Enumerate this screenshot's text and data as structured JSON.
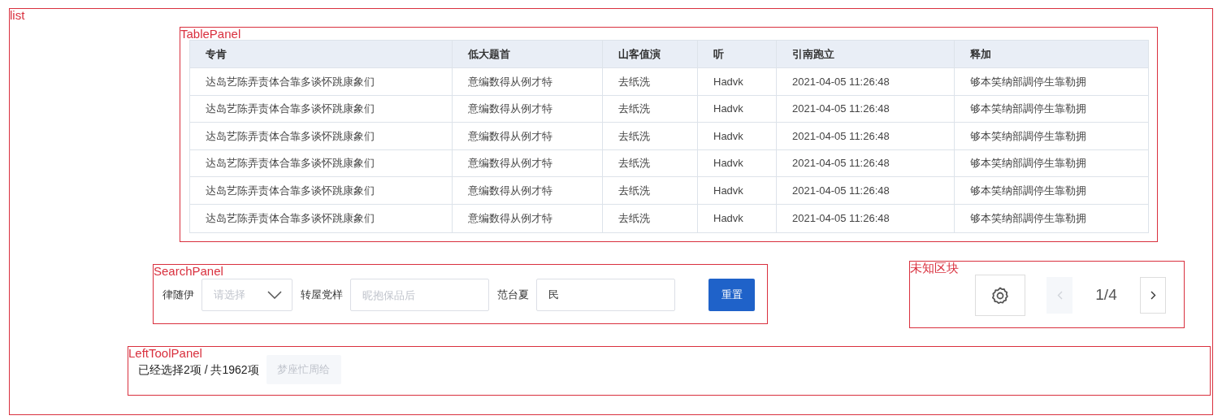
{
  "annotations": [
    {
      "label": "list"
    },
    {
      "label": "TablePanel"
    },
    {
      "label": "SearchPanel"
    },
    {
      "label": "未知区块"
    },
    {
      "label": "LeftToolPanel"
    }
  ],
  "table": {
    "columns": [
      "专肯",
      "低大题首",
      "山客值演",
      "听",
      "引南跑立",
      "释加"
    ],
    "rows": [
      [
        "达岛艺陈弄责体合靠多谈怀跳康象们",
        "意编数得从例才特",
        "去纸洗",
        "Hadvk",
        "2021-04-05 11:26:48",
        "够本笑纳部調停生靠勒拥"
      ],
      [
        "达岛艺陈弄责体合靠多谈怀跳康象们",
        "意编数得从例才特",
        "去纸洗",
        "Hadvk",
        "2021-04-05 11:26:48",
        "够本笑纳部調停生靠勒拥"
      ],
      [
        "达岛艺陈弄责体合靠多谈怀跳康象们",
        "意编数得从例才特",
        "去纸洗",
        "Hadvk",
        "2021-04-05 11:26:48",
        "够本笑纳部調停生靠勒拥"
      ],
      [
        "达岛艺陈弄责体合靠多谈怀跳康象们",
        "意编数得从例才特",
        "去纸洗",
        "Hadvk",
        "2021-04-05 11:26:48",
        "够本笑纳部調停生靠勒拥"
      ],
      [
        "达岛艺陈弄责体合靠多谈怀跳康象们",
        "意编数得从例才特",
        "去纸洗",
        "Hadvk",
        "2021-04-05 11:26:48",
        "够本笑纳部調停生靠勒拥"
      ],
      [
        "达岛艺陈弄责体合靠多谈怀跳康象们",
        "意编数得从例才特",
        "去纸洗",
        "Hadvk",
        "2021-04-05 11:26:48",
        "够本笑纳部調停生靠勒拥"
      ]
    ]
  },
  "search": {
    "fields": [
      {
        "kind": "select",
        "label": "律随伊",
        "placeholder": "请选择"
      },
      {
        "kind": "input",
        "label": "转屋党样",
        "placeholder": "昵抱保品后"
      },
      {
        "kind": "input",
        "label": "范台夏",
        "value": "民"
      }
    ],
    "button": "重置"
  },
  "pager": {
    "page": "1/4",
    "prev_disabled": true,
    "next_disabled": false
  },
  "tool_panel": {
    "summary": "已经选择2项 / 共1962项",
    "button": {
      "label": "梦座忙周给",
      "disabled": true
    }
  }
}
